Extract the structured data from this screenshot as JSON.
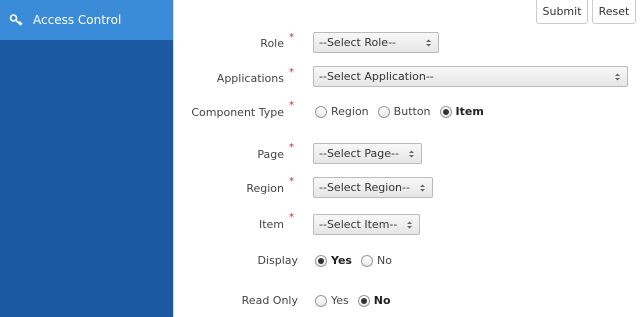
{
  "sidebar": {
    "active_item_label": "Access Control",
    "active_item_icon": "key-icon",
    "background": "#1b5aa3",
    "active_background": "#3a8bd8"
  },
  "toolbar": {
    "submit_label": "Submit",
    "reset_label": "Reset"
  },
  "form": {
    "role": {
      "label": "Role",
      "value": "--Select Role--"
    },
    "applications": {
      "label": "Applications",
      "value": "--Select Application--"
    },
    "component_type": {
      "label": "Component Type",
      "options": [
        "Region",
        "Button",
        "Item"
      ],
      "selected": "Item"
    },
    "page": {
      "label": "Page",
      "value": "--Select Page--"
    },
    "region": {
      "label": "Region",
      "value": "--Select Region--"
    },
    "item": {
      "label": "Item",
      "value": "--Select Item--"
    },
    "display": {
      "label": "Display",
      "options": [
        "Yes",
        "No"
      ],
      "selected": "Yes"
    },
    "read_only": {
      "label": "Read Only",
      "options": [
        "Yes",
        "No"
      ],
      "selected": "No"
    },
    "required_mark": "*"
  }
}
